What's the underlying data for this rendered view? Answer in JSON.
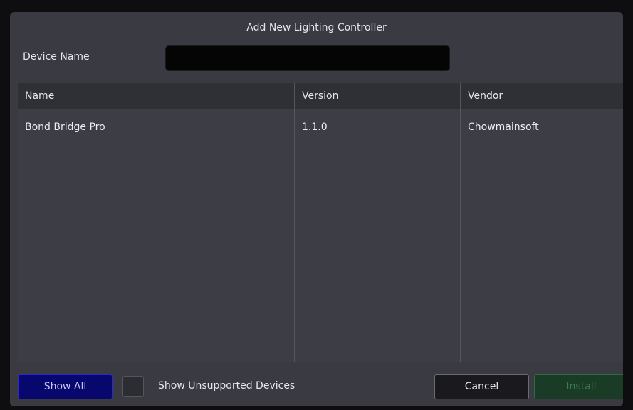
{
  "dialog": {
    "title": "Add New Lighting Controller"
  },
  "device_name": {
    "label": "Device Name",
    "value": "",
    "placeholder": ""
  },
  "table": {
    "columns": [
      "Name",
      "Version",
      "Vendor"
    ],
    "rows": [
      [
        "Bond Bridge Pro",
        "1.1.0",
        "Chowmainsoft"
      ]
    ]
  },
  "footer": {
    "show_all_label": "Show All",
    "show_unsupported_label": "Show Unsupported Devices",
    "show_unsupported_checked": false,
    "cancel_label": "Cancel",
    "install_label": "Install",
    "install_enabled": false
  },
  "colors": {
    "dialog_bg": "#3a3a42",
    "header_bg": "#2f2f36",
    "show_all_bg": "#07076e",
    "install_bg": "#1a3b25"
  }
}
